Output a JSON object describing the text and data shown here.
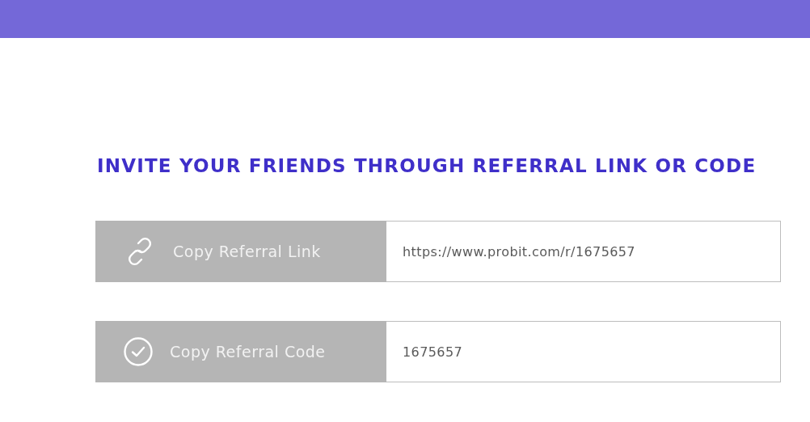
{
  "heading": "INVITE YOUR FRIENDS THROUGH REFERRAL LINK OR CODE",
  "rows": [
    {
      "kind": "link",
      "label": "Copy Referral Link",
      "value": "https://www.probit.com/r/1675657"
    },
    {
      "kind": "check",
      "label": "Copy Referral Code",
      "value": "1675657"
    }
  ]
}
